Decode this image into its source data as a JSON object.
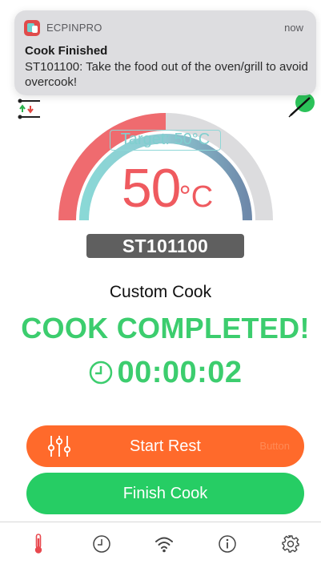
{
  "notification": {
    "app_name": "ECPINPRO",
    "time": "now",
    "title": "Cook Finished",
    "body": "ST101100: Take the food out of the oven/grill to avoid overcook!"
  },
  "gauge": {
    "target_label": "Target: 50°C",
    "temperature": "50",
    "unit": "°C",
    "device_id": "ST101100",
    "colors": {
      "hot": "#ef6b6f",
      "cool": "#6e89aa",
      "target": "#8fd7d7",
      "track": "#dcdcde"
    }
  },
  "cook": {
    "mode": "Custom Cook",
    "status": "COOK COMPLETED!",
    "elapsed": "00:00:02"
  },
  "buttons": {
    "start_rest": "Start Rest",
    "start_rest_hint": "Button",
    "finish_cook": "Finish Cook"
  },
  "tabbar": {
    "tabs": [
      {
        "icon": "thermometer-icon",
        "active": true
      },
      {
        "icon": "history-clock-icon",
        "active": false
      },
      {
        "icon": "wifi-icon",
        "active": false
      },
      {
        "icon": "info-icon",
        "active": false
      },
      {
        "icon": "settings-gear-icon",
        "active": false
      }
    ]
  },
  "colors": {
    "accent_green": "#3ccd6e",
    "rest_orange": "#ff6a2b",
    "finish_green": "#26cd64",
    "temp_red": "#ef5a5f"
  }
}
